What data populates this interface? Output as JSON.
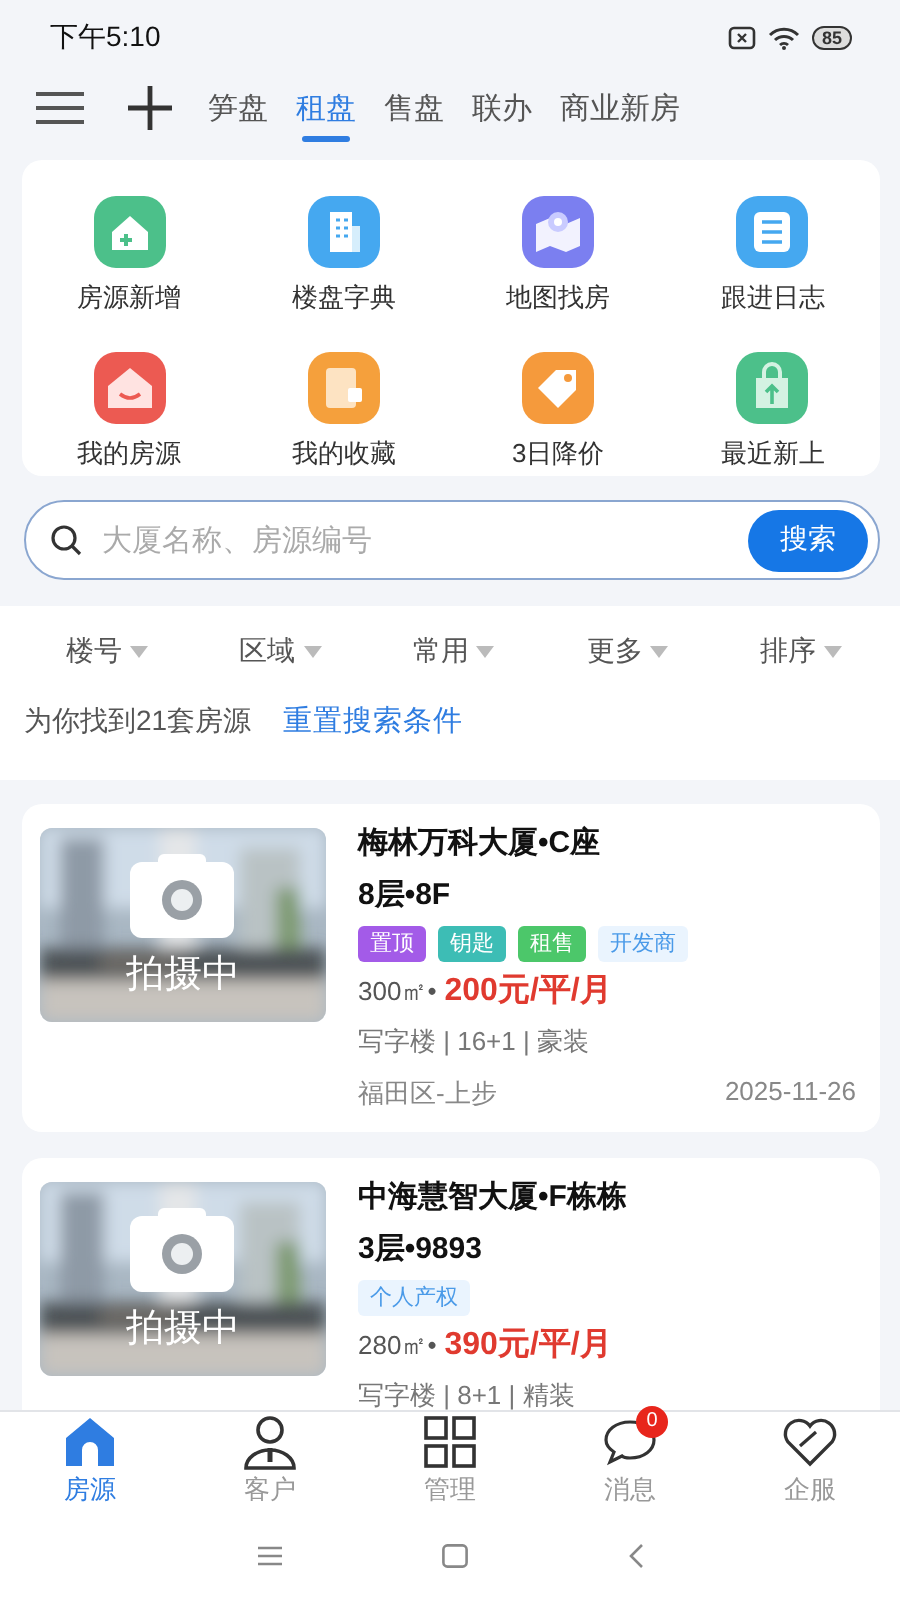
{
  "status_bar": {
    "time": "下午5:10",
    "battery": "85"
  },
  "top_tabs": [
    {
      "label": "笋盘",
      "selected": false
    },
    {
      "label": "租盘",
      "selected": true
    },
    {
      "label": "售盘",
      "selected": false
    },
    {
      "label": "联办",
      "selected": false
    },
    {
      "label": "商业新房",
      "selected": false
    }
  ],
  "quick_actions": [
    {
      "label": "房源新增",
      "kind": "house-add",
      "color": "#4cc08a"
    },
    {
      "label": "楼盘字典",
      "kind": "building",
      "color": "#45a8f0"
    },
    {
      "label": "地图找房",
      "kind": "map",
      "color": "#7b7ff0"
    },
    {
      "label": "跟进日志",
      "kind": "log",
      "color": "#45a8f0"
    },
    {
      "label": "我的房源",
      "kind": "home",
      "color": "#ec5a52"
    },
    {
      "label": "我的收藏",
      "kind": "folder",
      "color": "#f5a03c"
    },
    {
      "label": "3日降价",
      "kind": "tag",
      "color": "#f59a3c"
    },
    {
      "label": "最近新上",
      "kind": "bag",
      "color": "#4cc08a"
    }
  ],
  "search": {
    "placeholder": "大厦名称、房源编号",
    "button": "搜索"
  },
  "filters": [
    "楼号",
    "区域",
    "常用",
    "更多",
    "排序"
  ],
  "result_summary": "为你找到21套房源",
  "reset_link": "重置搜索条件",
  "listings": [
    {
      "photo_label": "拍摄中",
      "title": "梅林万科大厦•C座",
      "floor": "8层•8F",
      "tags": [
        {
          "label": "置顶",
          "kind": "solid",
          "color": "#a35be8"
        },
        {
          "label": "钥匙",
          "kind": "solid",
          "color": "#3dbdb5"
        },
        {
          "label": "租售",
          "kind": "solid",
          "color": "#4cc76a"
        },
        {
          "label": "开发商",
          "kind": "soft",
          "color": "#4a9ae8"
        }
      ],
      "area": "300㎡•",
      "price": "200元/平/月",
      "features": "写字楼 | 16+1 | 豪装",
      "district": "福田区-上步",
      "date": "2025-11-26"
    },
    {
      "photo_label": "拍摄中",
      "title": "中海慧智大厦•F栋栋",
      "floor": "3层•9893",
      "tags": [
        {
          "label": "个人产权",
          "kind": "soft",
          "color": "#4a9ae8"
        }
      ],
      "area": "280㎡•",
      "price": "390元/平/月",
      "features": "写字楼 | 8+1 | 精装"
    }
  ],
  "bottom_nav": [
    {
      "label": "房源",
      "kind": "house",
      "selected": true
    },
    {
      "label": "客户",
      "kind": "person",
      "selected": false
    },
    {
      "label": "管理",
      "kind": "grid",
      "selected": false
    },
    {
      "label": "消息",
      "kind": "chat",
      "selected": false,
      "badge": "0"
    },
    {
      "label": "企服",
      "kind": "heart",
      "selected": false
    }
  ]
}
